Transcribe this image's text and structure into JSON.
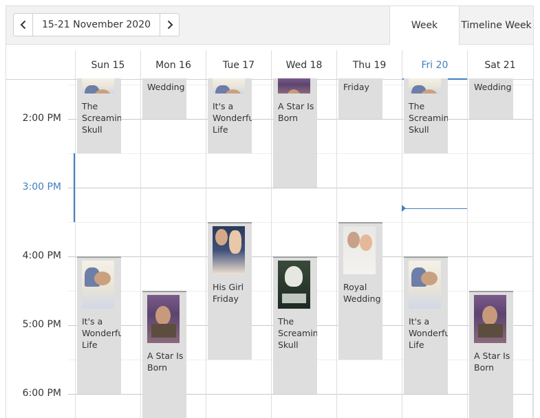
{
  "toolbar": {
    "date_range": "15-21 November 2020",
    "prev_icon": "chevron-left-icon",
    "next_icon": "chevron-right-icon",
    "views": [
      "Week",
      "Timeline Week"
    ],
    "selected_view": "Week"
  },
  "days": [
    {
      "label": "Sun 15"
    },
    {
      "label": "Mon 16"
    },
    {
      "label": "Tue 17"
    },
    {
      "label": "Wed 18"
    },
    {
      "label": "Thu 19"
    },
    {
      "label": "Fri 20",
      "today": true
    },
    {
      "label": "Sat 21"
    }
  ],
  "times": [
    {
      "label": "2:00 PM"
    },
    {
      "label": "3:00 PM",
      "current": true
    },
    {
      "label": "4:00 PM"
    },
    {
      "label": "5:00 PM"
    },
    {
      "label": "6:00 PM"
    }
  ],
  "events": [
    {
      "day": 0,
      "start": "13:00",
      "end": "14:30",
      "title": "The Screaming Skull",
      "poster": "wonderful",
      "partial_text": "",
      "poster_visible": true
    },
    {
      "day": 0,
      "start": "16:00",
      "end": "18:00",
      "title": "It's a Wonderful Life",
      "poster": "wonderful"
    },
    {
      "day": 1,
      "start": "13:00",
      "end": "14:00",
      "title": "Wedding",
      "continuation": true
    },
    {
      "day": 1,
      "start": "16:30",
      "end": "18:30",
      "title": "A Star Is Born",
      "poster": "star"
    },
    {
      "day": 2,
      "start": "13:00",
      "end": "14:30",
      "title": "It's a Wonderful Life",
      "poster": "wonderful"
    },
    {
      "day": 2,
      "start": "15:30",
      "end": "17:30",
      "title": "His Girl Friday",
      "poster": "friday"
    },
    {
      "day": 3,
      "start": "13:00",
      "end": "15:00",
      "title": "A Star Is Born",
      "poster": "star"
    },
    {
      "day": 3,
      "start": "16:00",
      "end": "18:00",
      "title": "The Screaming Skull",
      "poster": "skull"
    },
    {
      "day": 4,
      "start": "13:00",
      "end": "14:00",
      "title": "Friday",
      "continuation": true
    },
    {
      "day": 4,
      "start": "15:30",
      "end": "17:30",
      "title": "Royal Wedding",
      "poster": "royal"
    },
    {
      "day": 5,
      "start": "13:00",
      "end": "14:30",
      "title": "The Screaming Skull",
      "poster": "wonderful"
    },
    {
      "day": 5,
      "start": "16:00",
      "end": "18:00",
      "title": "It's a Wonderful Life",
      "poster": "wonderful"
    },
    {
      "day": 6,
      "start": "13:00",
      "end": "14:00",
      "title": "Wedding",
      "continuation": true
    },
    {
      "day": 6,
      "start": "16:30",
      "end": "18:30",
      "title": "A Star Is Born",
      "poster": "star"
    }
  ],
  "current_time": "15:18",
  "colors": {
    "accent": "#3e80c0",
    "event_bg": "#dedede",
    "event_border": "#9e9e9e"
  }
}
